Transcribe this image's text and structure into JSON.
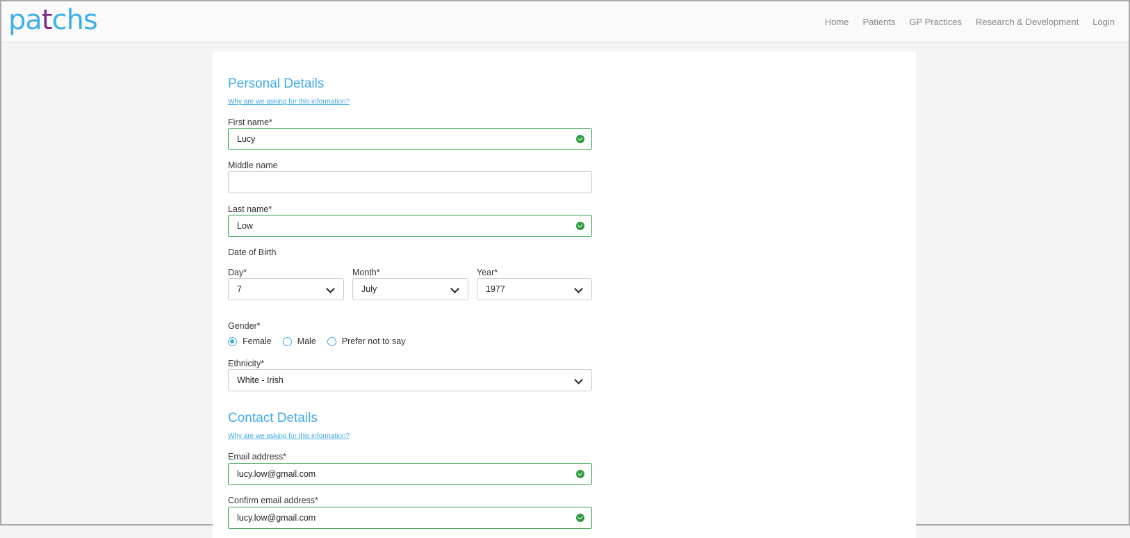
{
  "header": {
    "logo_part1": "pa",
    "logo_part2": "t",
    "logo_part3": "chs",
    "nav": {
      "home": "Home",
      "patients": "Patients",
      "gp_practices": "GP Practices",
      "research": "Research & Development",
      "login": "Login"
    }
  },
  "personal": {
    "title": "Personal Details",
    "why_link": "Why are we asking for this information?",
    "first_name_label": "First name*",
    "first_name_value": "Lucy",
    "middle_name_label": "Middle name",
    "middle_name_value": "",
    "last_name_label": "Last name*",
    "last_name_value": "Low",
    "dob_label": "Date of Birth",
    "day_label": "Day*",
    "day_value": "7",
    "month_label": "Month*",
    "month_value": "July",
    "year_label": "Year*",
    "year_value": "1977",
    "gender_label": "Gender*",
    "gender_options": [
      "Female",
      "Male",
      "Prefer not to say"
    ],
    "gender_selected": "Female",
    "ethnicity_label": "Ethnicity*",
    "ethnicity_value": "White - Irish"
  },
  "contact": {
    "title": "Contact Details",
    "why_link": "Why are we asking for this information?",
    "email_label": "Email address*",
    "email_value": "lucy.low@gmail.com",
    "confirm_email_label": "Confirm email address*",
    "confirm_email_value": "lucy.low@gmail.com"
  },
  "colors": {
    "accent": "#3fa9e8",
    "valid": "#2e9e3e",
    "logo_accent": "#7b2a8a"
  }
}
